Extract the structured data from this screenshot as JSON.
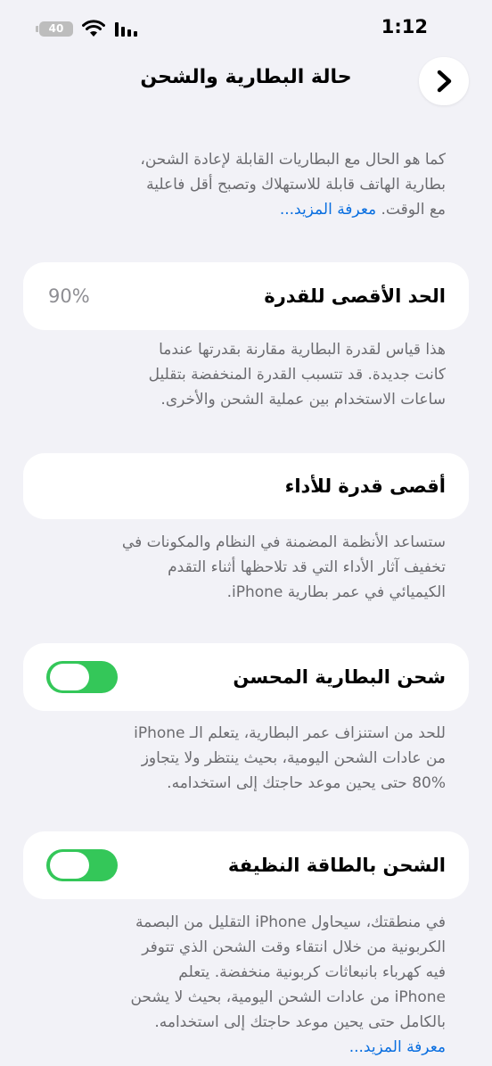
{
  "status_bar": {
    "time": "1:12",
    "battery_level": "40",
    "icons": [
      "battery-icon",
      "wifi-icon",
      "signal-icon"
    ]
  },
  "nav": {
    "title": "حالة البطارية والشحن",
    "back_icon": "chevron-icon"
  },
  "intro": {
    "lines": [
      "كما هو الحال مع البطاريات القابلة لإعادة الشحن،",
      "بطارية الهاتف قابلة للاستهلاك وتصبح أقل فاعلية"
    ],
    "last_line_text": "مع الوقت.",
    "learn_more": "معرفة المزيد..."
  },
  "maximum_capacity": {
    "label": "الحد الأقصى للقدرة",
    "value": "90%",
    "footer_lines": [
      "هذا قياس لقدرة البطارية مقارنة بقدرتها عندما",
      "كانت جديدة. قد تتسبب القدرة المنخفضة بتقليل",
      "ساعات الاستخدام بين عملية الشحن والأخرى."
    ]
  },
  "peak_performance": {
    "label": "أقصى قدرة للأداء",
    "footer_lines": [
      "ستساعد الأنظمة المضمنة في النظام والمكونات في",
      "تخفيف آثار الأداء التي قد تلاحظها أثناء التقدم",
      "الكيميائي في عمر بطارية iPhone."
    ]
  },
  "optimized_charging": {
    "label": "شحن البطارية المحسن",
    "enabled": true,
    "footer_lines": [
      "للحد من استنزاف عمر البطارية، يتعلم الـ iPhone",
      "من عادات الشحن اليومية، بحيث ينتظر ولا يتجاوز",
      "80% حتى يحين موعد حاجتك إلى استخدامه."
    ]
  },
  "clean_energy_charging": {
    "label": "الشحن بالطاقة النظيفة",
    "enabled": true,
    "footer_lines": [
      "في منطقتك، سيحاول iPhone التقليل من البصمة",
      "الكربونية من خلال انتقاء وقت الشحن الذي تتوفر",
      "فيه كهرباء بانبعاثات كربونية منخفضة. يتعلم",
      "iPhone من عادات الشحن اليومية، بحيث لا يشحن",
      "بالكامل حتى يحين موعد حاجتك إلى استخدامه."
    ],
    "learn_more": "معرفة المزيد..."
  },
  "colors": {
    "background": "#f2f2f7",
    "card": "#ffffff",
    "toggle_on": "#34c759",
    "link": "#0a6fe0",
    "footer_text": "#6c6c70"
  }
}
